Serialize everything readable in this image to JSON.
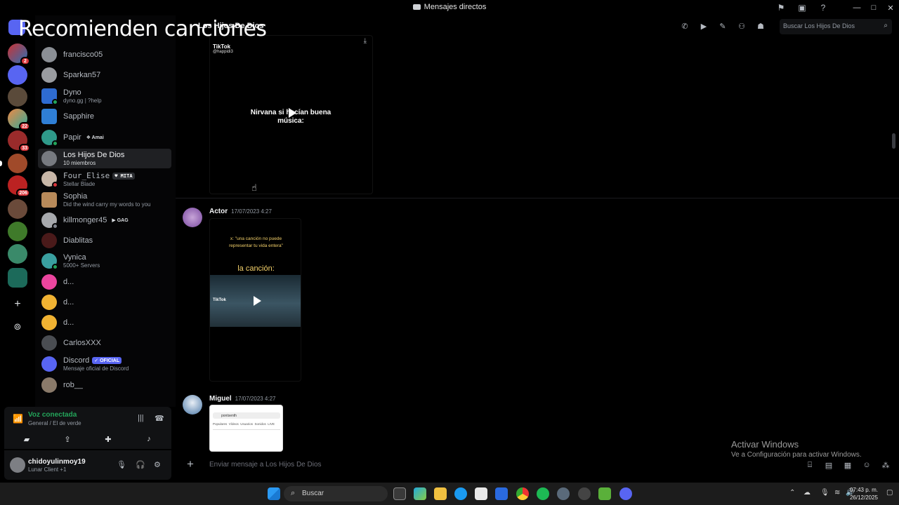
{
  "window": {
    "title": "Mensajes directos",
    "controls": {
      "minimize": "—",
      "maximize": "□",
      "close": "✕"
    }
  },
  "overlay_caption": "Recomienden canciones",
  "rail": {
    "badges": [
      "2",
      "22",
      "33",
      "206"
    ]
  },
  "dm_list": [
    {
      "name": "francisco05",
      "sub": "",
      "tag": ""
    },
    {
      "name": "Sparkan57",
      "sub": "",
      "tag": ""
    },
    {
      "name": "Dyno",
      "sub": "dyno.gg | ?help",
      "tag": ""
    },
    {
      "name": "Sapphire",
      "sub": "",
      "tag": ""
    },
    {
      "name": "Papir",
      "sub": "",
      "tag": "Amai"
    },
    {
      "name": "Los Hijos De Dios",
      "sub": "10 miembros",
      "tag": ""
    },
    {
      "name": "Four_Elise",
      "sub": "Stellar Blade",
      "tag": "MITA"
    },
    {
      "name": "Sophia",
      "sub": "Did the wind carry my words to you",
      "tag": ""
    },
    {
      "name": "killmonger45",
      "sub": "",
      "tag": "GAG"
    },
    {
      "name": "Diablitas",
      "sub": "",
      "tag": ""
    },
    {
      "name": "Vynica",
      "sub": "5000+ Servers",
      "tag": ""
    },
    {
      "name": "d...",
      "sub": "",
      "tag": ""
    },
    {
      "name": "d...",
      "sub": "",
      "tag": ""
    },
    {
      "name": "d...",
      "sub": "",
      "tag": ""
    },
    {
      "name": "CarlosXXX",
      "sub": "",
      "tag": ""
    },
    {
      "name": "Discord",
      "sub": "Mensaje oficial de Discord",
      "tag": "OFICIAL"
    },
    {
      "name": "rob__",
      "sub": "",
      "tag": ""
    }
  ],
  "voice": {
    "title": "Voz conectada",
    "channel": "General / El de verde"
  },
  "user": {
    "name": "chidoyulinmoy19",
    "status": "Lunar Client +1"
  },
  "channel": {
    "name": "Los Hijos De Dios",
    "search_placeholder": "Buscar Los Hijos De Dios"
  },
  "messages": [
    {
      "tiktok_label": "TikTok",
      "tiktok_handle": "@happidi3",
      "video_text": "Nirvana si hacían buena música:"
    },
    {
      "author": "Actor",
      "timestamp": "17/07/2023 4:27",
      "caption_top": "x: \"una canción no puede representar tu vida entera\"",
      "caption_main": "la canción:",
      "tiktok_label": "TikTok"
    },
    {
      "author": "Miguel",
      "timestamp": "17/07/2023 4:27",
      "shot_search": "pontsenth",
      "shot_tabs": "Populares  Vídeos  Usuarios  Sonidos  LIVE"
    }
  ],
  "composer": {
    "placeholder": "Enviar mensaje a Los Hijos De Dios"
  },
  "watermark": {
    "line1": "Activar Windows",
    "line2": "Ve a Configuración para activar Windows."
  },
  "taskbar": {
    "search": "Buscar",
    "time": "07:43 p. m.",
    "date": "26/12/2025"
  },
  "colors": {
    "accent": "#5865f2",
    "online": "#23a55a",
    "badge": "#da373c"
  }
}
